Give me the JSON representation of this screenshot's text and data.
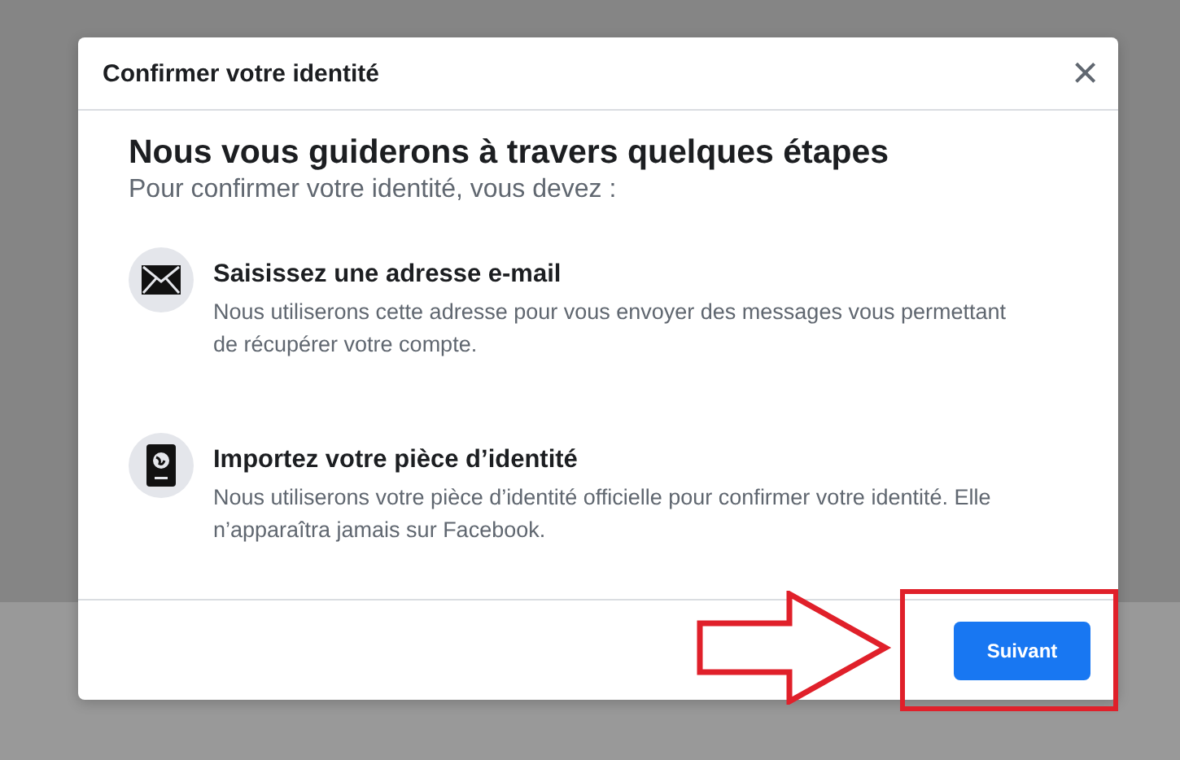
{
  "dialog": {
    "title": "Confirmer votre identité",
    "close": "×",
    "heading": "Nous vous guiderons à travers quelques étapes",
    "subtitle": "Pour confirmer votre identité, vous devez :",
    "steps": [
      {
        "kind": "email",
        "title": "Saisissez une adresse e-mail",
        "description": "Nous utiliserons cette adresse pour vous envoyer des messages vous permettant de récupérer votre compte."
      },
      {
        "kind": "id",
        "title": "Importez votre pièce d’identité",
        "description": "Nous utiliserons votre pièce d’identité officielle pour confirmer votre identité. Elle n’apparaîtra jamais sur Facebook."
      }
    ],
    "button": "Suivant"
  }
}
